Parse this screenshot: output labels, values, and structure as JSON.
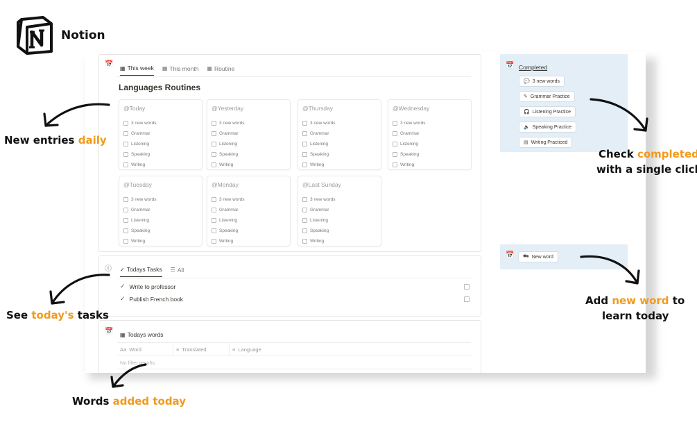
{
  "brand": {
    "name": "Notion"
  },
  "main": {
    "tabs": [
      {
        "label": "This week",
        "icon": "calendar-icon"
      },
      {
        "label": "This month",
        "icon": "calendar-icon"
      },
      {
        "label": "Routine",
        "icon": "calendar-icon"
      }
    ],
    "title": "Languages Routines",
    "tasks": [
      "3 new words",
      "Grammar",
      "Listening",
      "Speaking",
      "Writing"
    ],
    "days": [
      "@Today",
      "@Yesterday",
      "@Thursday",
      "@Wednesday",
      "@Tuesday",
      "@Monday",
      "@Last Sunday"
    ]
  },
  "today_tasks": {
    "tabs": [
      {
        "label": "Todays Tasks",
        "icon": "check-icon"
      },
      {
        "label": "All",
        "icon": "list-icon"
      }
    ],
    "rows": [
      "Write to professor",
      "Publish French book"
    ]
  },
  "today_words": {
    "tab": "Todays words",
    "columns": [
      "Word",
      "Translated",
      "Language"
    ],
    "column_prefix": "Aa",
    "empty_text": "No filter results."
  },
  "completed": {
    "title": "Completed",
    "chips": [
      {
        "label": "3 new words",
        "icon": "speech-bubble-icon"
      },
      {
        "label": "Grammar Practice",
        "icon": "pen-icon"
      },
      {
        "label": "Listening Practice",
        "icon": "headphones-icon"
      },
      {
        "label": "Speaking Practice",
        "icon": "speaker-icon"
      },
      {
        "label": "Writing Practiced",
        "icon": "document-icon"
      }
    ]
  },
  "new_word": {
    "label": "New word",
    "icon": "translate-icon"
  },
  "annotations": {
    "daily": {
      "prefix": "New entries ",
      "highlight": "daily"
    },
    "tasks": {
      "prefix": "See ",
      "highlight": "today's",
      "suffix": " tasks"
    },
    "words": {
      "prefix": "Words ",
      "highlight": "added today"
    },
    "completed": {
      "line1_prefix": "Check ",
      "line1_highlight": "completed",
      "line2": "with a single click"
    },
    "add_word": {
      "line1_prefix": "Add ",
      "line1_highlight": "new word",
      "line1_suffix": " to",
      "line2": "learn today"
    }
  },
  "colors": {
    "accent": "#f29a1d",
    "panel_blue": "#e3eef7",
    "text": "#37352f",
    "muted": "#9b9a97"
  }
}
